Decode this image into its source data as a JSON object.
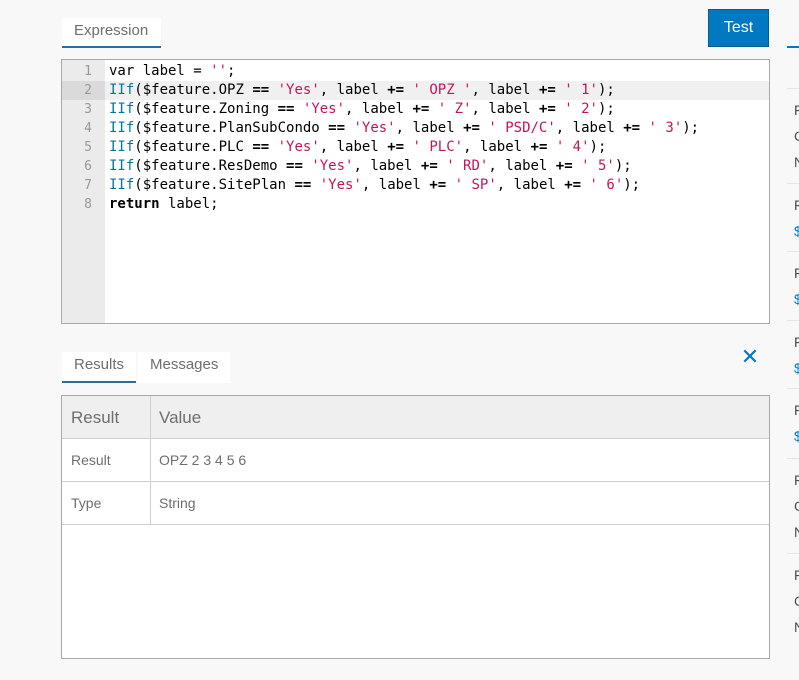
{
  "tabs": {
    "expression": "Expression",
    "results": "Results",
    "messages": "Messages"
  },
  "test_button": "Test",
  "editor": {
    "line_numbers": [
      "1",
      "2",
      "3",
      "4",
      "5",
      "6",
      "7",
      "8"
    ],
    "lines": [
      "var label = '';",
      "IIf($feature.OPZ == 'Yes', label += ' OPZ ', label += ' 1');",
      "IIf($feature.Zoning == 'Yes', label += ' Z', label += ' 2');",
      "IIf($feature.PlanSubCondo == 'Yes', label += ' PSD/C', label += ' 3');",
      "IIf($feature.PLC == 'Yes', label += ' PLC', label += ' 4');",
      "IIf($feature.ResDemo == 'Yes', label += ' RD', label += ' 5');",
      "IIf($feature.SitePlan == 'Yes', label += ' SP', label += ' 6');",
      "return label;"
    ],
    "active_line": 2
  },
  "results_table": {
    "headers": [
      "Result",
      "Value"
    ],
    "rows": [
      [
        "Result",
        "OPZ 2 3 4 5 6"
      ],
      [
        "Type",
        "String"
      ]
    ]
  },
  "side_panel": {
    "items": [
      {
        "chars": [
          "F",
          "C",
          "N"
        ],
        "link": false
      },
      {
        "chars": [
          "F",
          "$"
        ],
        "link": true
      },
      {
        "chars": [
          "F",
          "$"
        ],
        "link": true
      },
      {
        "chars": [
          "F",
          "$"
        ],
        "link": true
      },
      {
        "chars": [
          "F",
          "$"
        ],
        "link": true
      },
      {
        "chars": [
          "F",
          "C",
          "N"
        ],
        "link": false
      },
      {
        "chars": [
          "F",
          "C",
          "N"
        ],
        "link": false
      }
    ]
  },
  "colors": {
    "accent": "#0079c1",
    "string": "#c7135b",
    "function": "#00779a"
  }
}
